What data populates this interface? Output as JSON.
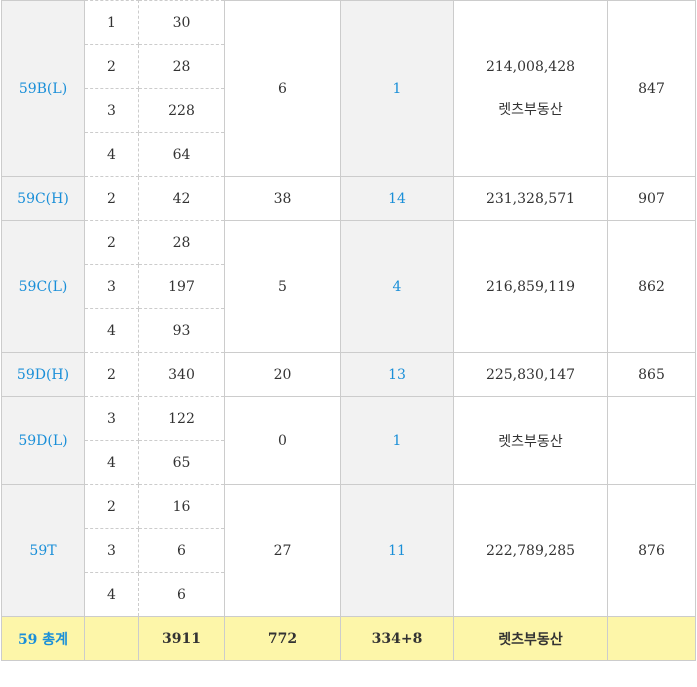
{
  "rows": {
    "b59l": {
      "type": "59B(L)",
      "sub": [
        {
          "floor": "1",
          "count": "30"
        },
        {
          "floor": "2",
          "count": "28"
        },
        {
          "floor": "3",
          "count": "228"
        },
        {
          "floor": "4",
          "count": "64"
        }
      ],
      "c4": "6",
      "c5": "1",
      "price": "214,008,428",
      "agent": "렛츠부동산",
      "last": "847"
    },
    "c59h": {
      "type": "59C(H)",
      "floor": "2",
      "count": "42",
      "c4": "38",
      "c5": "14",
      "price": "231,328,571",
      "last": "907"
    },
    "c59l": {
      "type": "59C(L)",
      "sub": [
        {
          "floor": "2",
          "count": "28"
        },
        {
          "floor": "3",
          "count": "197"
        },
        {
          "floor": "4",
          "count": "93"
        }
      ],
      "c4": "5",
      "c5": "4",
      "price": "216,859,119",
      "last": "862"
    },
    "d59h": {
      "type": "59D(H)",
      "floor": "2",
      "count": "340",
      "c4": "20",
      "c5": "13",
      "price": "225,830,147",
      "last": "865"
    },
    "d59l": {
      "type": "59D(L)",
      "sub": [
        {
          "floor": "3",
          "count": "122"
        },
        {
          "floor": "4",
          "count": "65"
        }
      ],
      "c4": "0",
      "c5": "1",
      "agent": "렛츠부동산",
      "last": ""
    },
    "t59": {
      "type": "59T",
      "sub": [
        {
          "floor": "2",
          "count": "16"
        },
        {
          "floor": "3",
          "count": "6"
        },
        {
          "floor": "4",
          "count": "6"
        }
      ],
      "c4": "27",
      "c5": "11",
      "price": "222,789,285",
      "last": "876"
    }
  },
  "total": {
    "label": "59 총계",
    "floor": "",
    "count": "3911",
    "c4": "772",
    "c5": "334+8",
    "agent": "렛츠부동산",
    "last": ""
  },
  "colors": {
    "accent_blue": "#1a8fd8",
    "total_bg": "#fdf6a9",
    "type_bg": "#f2f2f2"
  }
}
